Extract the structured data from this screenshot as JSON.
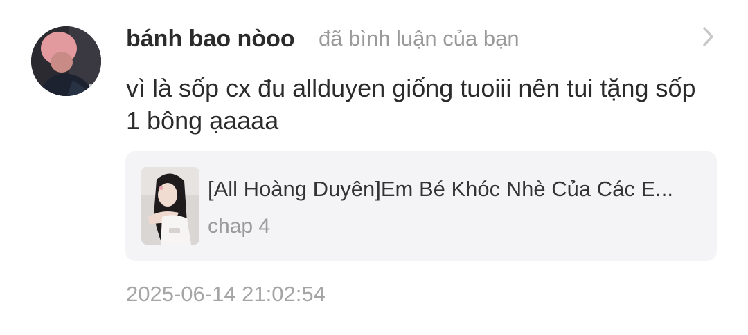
{
  "notification": {
    "username": "bánh bao nòoo",
    "action": "đã bình luận của bạn",
    "comment": "vì là sốp cx đu allduyen giống tuoiii nên tui tặng sốp 1 bông ạaaaa",
    "timestamp": "2025-06-14 21:02:54"
  },
  "story": {
    "title": "[All Hoàng Duyên]Em Bé Khóc Nhè Của Các E...",
    "chapter": "chap 4"
  },
  "icons": {
    "chevron": "chevron-right-icon",
    "avatar": "user-avatar",
    "cover": "story-cover-image"
  },
  "colors": {
    "primary_text": "#2b2b2b",
    "secondary_text": "#9a9a9a",
    "card_background": "#f4f4f6",
    "chevron": "#c8c8c8"
  }
}
